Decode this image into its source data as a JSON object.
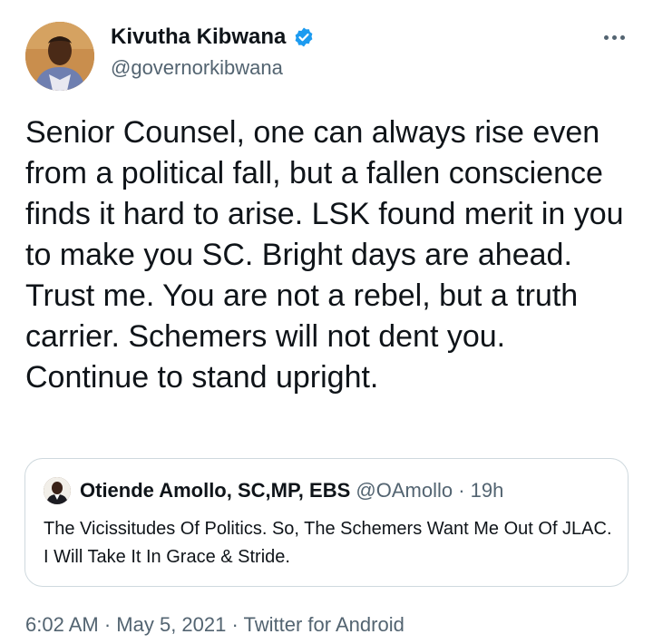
{
  "author": {
    "display_name": "Kivutha Kibwana",
    "handle": "@governorkibwana",
    "verified": true,
    "verified_color": "#1d9bf0",
    "avatar_icon": "profile-photo"
  },
  "menu": {
    "icon": "more-horizontal-icon"
  },
  "tweet": {
    "text": "Senior Counsel, one can always rise even from a political fall, but a fallen conscience finds it hard to arise. LSK found merit in you to make you SC. Bright days are ahead. Trust me. You are not a rebel, but a truth carrier. Schemers will not dent you. Continue to stand upright."
  },
  "quoted_tweet": {
    "display_name": "Otiende Amollo, SC,MP, EBS",
    "handle": "@OAmollo",
    "separator": " · ",
    "time": "19h",
    "text": "The Vicissitudes Of Politics. So, The Schemers Want Me Out Of JLAC. I Will Take It In Grace & Stride."
  },
  "footer": {
    "time": "6:02 AM",
    "separator": " · ",
    "date": "May 5, 2021",
    "source": "Twitter for Android"
  }
}
